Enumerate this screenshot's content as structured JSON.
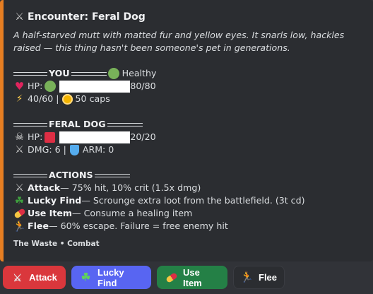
{
  "embed": {
    "accent_color": "#e67e22",
    "title_icon": "crossed-swords-icon",
    "title": "Encounter: Feral Dog",
    "description": "A half-starved mutt with matted fur and yellow eyes. It snarls low, hackles raised — this thing hasn't been someone's pet in generations.",
    "you_header": "YOU",
    "you_status_icon": "green-circle-icon",
    "you_status": "Healthy",
    "you_hp_label": "HP:",
    "you_hp_value": "80/80",
    "you_hp_fraction": 1.0,
    "you_energy": "40/60 |",
    "you_caps": "50 caps",
    "enemy_header": "FERAL DOG",
    "enemy_hp_label": "HP:",
    "enemy_hp_value": "20/20",
    "enemy_hp_fraction": 1.0,
    "enemy_dmg": "DMG: 6 |",
    "enemy_arm": "ARM: 0",
    "actions_header": "ACTIONS",
    "actions": [
      {
        "icon": "crossed-swords-icon",
        "name": "Attack",
        "desc": " — 75% hit, 10% crit (1.5x dmg)"
      },
      {
        "icon": "four-leaf-clover-icon",
        "name": "Lucky Find",
        "desc": " — Scrounge extra loot from the battlefield. (3t cd)"
      },
      {
        "icon": "pill-icon",
        "name": "Use Item",
        "desc": " — Consume a healing item"
      },
      {
        "icon": "running-person-icon",
        "name": "Flee",
        "desc": " — 60% escape. Failure = free enemy hit"
      }
    ],
    "footer": "The Waste • Combat"
  },
  "buttons": [
    {
      "label": "Attack",
      "icon": "crossed-swords-icon",
      "color": "#da373c"
    },
    {
      "label": "Lucky Find",
      "icon": "four-leaf-clover-icon",
      "color": "#5865f2"
    },
    {
      "label": "Use Item",
      "icon": "pill-icon",
      "color": "#248046"
    },
    {
      "label": "Flee",
      "icon": "running-person-icon",
      "color": "#2b2d31"
    }
  ]
}
